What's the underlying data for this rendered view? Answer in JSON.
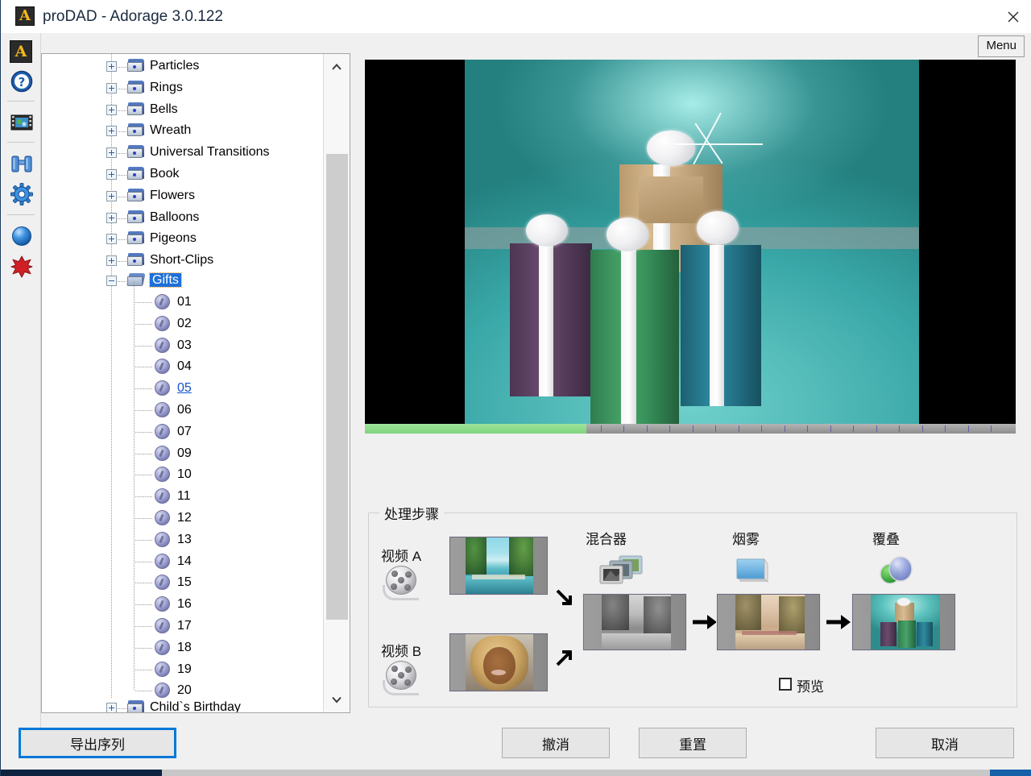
{
  "window": {
    "title": "proDAD - Adorage 3.0.122",
    "app_icon": "A",
    "close_icon": "close-icon"
  },
  "menu": {
    "label": "Menu"
  },
  "rail": {
    "items": [
      {
        "name": "app-logo-icon",
        "label": "A"
      },
      {
        "name": "help-icon",
        "label": "?"
      },
      {
        "name": "media-icon",
        "label": ""
      },
      {
        "name": "binoculars-icon",
        "label": ""
      },
      {
        "name": "settings-gear-icon",
        "label": ""
      },
      {
        "name": "sphere-icon",
        "label": ""
      },
      {
        "name": "delete-icon",
        "label": ""
      }
    ]
  },
  "tree": {
    "folders": [
      {
        "label": "Particles",
        "expanded": false
      },
      {
        "label": "Rings",
        "expanded": false
      },
      {
        "label": "Bells",
        "expanded": false
      },
      {
        "label": "Wreath",
        "expanded": false
      },
      {
        "label": "Universal Transitions",
        "expanded": false
      },
      {
        "label": "Book",
        "expanded": false
      },
      {
        "label": "Flowers",
        "expanded": false
      },
      {
        "label": "Balloons",
        "expanded": false
      },
      {
        "label": "Pigeons",
        "expanded": false
      },
      {
        "label": "Short-Clips",
        "expanded": false
      }
    ],
    "selected_folder": {
      "label": "Gifts",
      "expanded": true
    },
    "children": [
      "01",
      "02",
      "03",
      "04",
      "05",
      "06",
      "07",
      "09",
      "10",
      "11",
      "12",
      "13",
      "14",
      "15",
      "16",
      "17",
      "18",
      "19",
      "20"
    ],
    "active_child": "05",
    "last_folder": {
      "label": "Child`s Birthday",
      "expanded": false
    },
    "selection_color": "#1e6fd9",
    "link_color": "#1452c8"
  },
  "scrollbar": {
    "up_icon": "chevron-up-icon",
    "down_icon": "chevron-down-icon"
  },
  "preview": {
    "progress_percent": 34,
    "progress_color": "#7ed47c"
  },
  "process": {
    "title": "处理步骤",
    "video_a_label": "视频 A",
    "video_b_label": "视频 B",
    "mixer_label": "混合器",
    "smoke_label": "烟雾",
    "overlay_label": "覆叠",
    "preview_checkbox_label": "预览",
    "preview_checked": false
  },
  "buttons": {
    "export": "导出序列",
    "undo": "撤消",
    "reset": "重置",
    "cancel": "取消"
  }
}
